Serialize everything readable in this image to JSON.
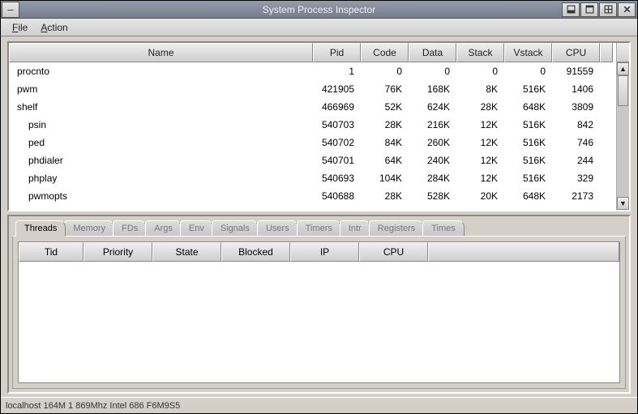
{
  "window": {
    "title": "System Process Inspector"
  },
  "menu": {
    "file": "File",
    "action": "Action"
  },
  "proc_headers": {
    "name": "Name",
    "pid": "Pid",
    "code": "Code",
    "data": "Data",
    "stack": "Stack",
    "vstack": "Vstack",
    "cpu": "CPU"
  },
  "processes": [
    {
      "name": "procnto",
      "indent": 0,
      "pid": "1",
      "code": "0",
      "data": "0",
      "stack": "0",
      "vstack": "0",
      "cpu": "91559"
    },
    {
      "name": "pwm",
      "indent": 0,
      "pid": "421905",
      "code": "76K",
      "data": "168K",
      "stack": "8K",
      "vstack": "516K",
      "cpu": "1406"
    },
    {
      "name": "shelf",
      "indent": 0,
      "pid": "466969",
      "code": "52K",
      "data": "624K",
      "stack": "28K",
      "vstack": "648K",
      "cpu": "3809"
    },
    {
      "name": "psin",
      "indent": 1,
      "pid": "540703",
      "code": "28K",
      "data": "216K",
      "stack": "12K",
      "vstack": "516K",
      "cpu": "842"
    },
    {
      "name": "ped",
      "indent": 1,
      "pid": "540702",
      "code": "84K",
      "data": "260K",
      "stack": "12K",
      "vstack": "516K",
      "cpu": "746"
    },
    {
      "name": "phdialer",
      "indent": 1,
      "pid": "540701",
      "code": "64K",
      "data": "240K",
      "stack": "12K",
      "vstack": "516K",
      "cpu": "244"
    },
    {
      "name": "phplay",
      "indent": 1,
      "pid": "540693",
      "code": "104K",
      "data": "284K",
      "stack": "12K",
      "vstack": "516K",
      "cpu": "329"
    },
    {
      "name": "pwmopts",
      "indent": 1,
      "pid": "540688",
      "code": "28K",
      "data": "528K",
      "stack": "20K",
      "vstack": "648K",
      "cpu": "2173"
    }
  ],
  "tabs": [
    "Threads",
    "Memory",
    "FDs",
    "Args",
    "Env",
    "Signals",
    "Users",
    "Timers",
    "Intr",
    "Registers",
    "Times"
  ],
  "thread_headers": {
    "tid": "Tid",
    "priority": "Priority",
    "state": "State",
    "blocked": "Blocked",
    "ip": "IP",
    "cpu": "CPU"
  },
  "status": "localhost  164M 1 869Mhz Intel 686 F6M9S5"
}
